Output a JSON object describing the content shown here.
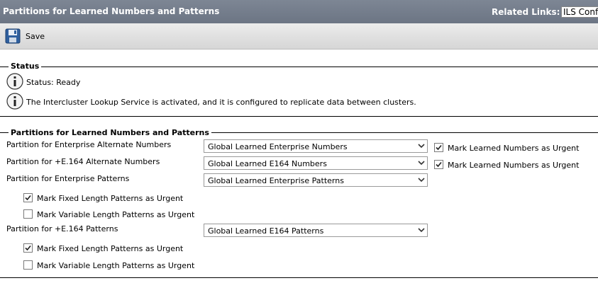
{
  "header": {
    "title": "Partitions for Learned Numbers and Patterns",
    "related_links_label": "Related Links:",
    "related_links_value": "ILS Configuration"
  },
  "toolbar": {
    "save_label": "Save",
    "save_icon": "floppy-disk-icon"
  },
  "status_section": {
    "title": "Status",
    "messages": [
      {
        "icon": "info-icon",
        "text": "Status: Ready"
      },
      {
        "icon": "info-icon",
        "text": "The Intercluster Lookup Service is activated, and it is configured to replicate data between clusters."
      }
    ]
  },
  "partitions_section": {
    "title": "Partitions for Learned Numbers and Patterns",
    "enterprise_alternate": {
      "label": "Partition for Enterprise Alternate Numbers",
      "value": "Global Learned Enterprise Numbers",
      "urgent_label": "Mark Learned Numbers as Urgent",
      "urgent_checked": true
    },
    "e164_alternate": {
      "label": "Partition for +E.164 Alternate Numbers",
      "value": "Global Learned E164 Numbers",
      "urgent_label": "Mark Learned Numbers as Urgent",
      "urgent_checked": true
    },
    "enterprise_patterns": {
      "label": "Partition for Enterprise Patterns",
      "value": "Global Learned Enterprise Patterns",
      "fixed_label": "Mark Fixed Length Patterns as Urgent",
      "fixed_checked": true,
      "variable_label": "Mark Variable Length Patterns as Urgent",
      "variable_checked": false
    },
    "e164_patterns": {
      "label": "Partition for +E.164 Patterns",
      "value": "Global Learned E164 Patterns",
      "fixed_label": "Mark Fixed Length Patterns as Urgent",
      "fixed_checked": true,
      "variable_label": "Mark Variable Length Patterns as Urgent",
      "variable_checked": false
    }
  }
}
